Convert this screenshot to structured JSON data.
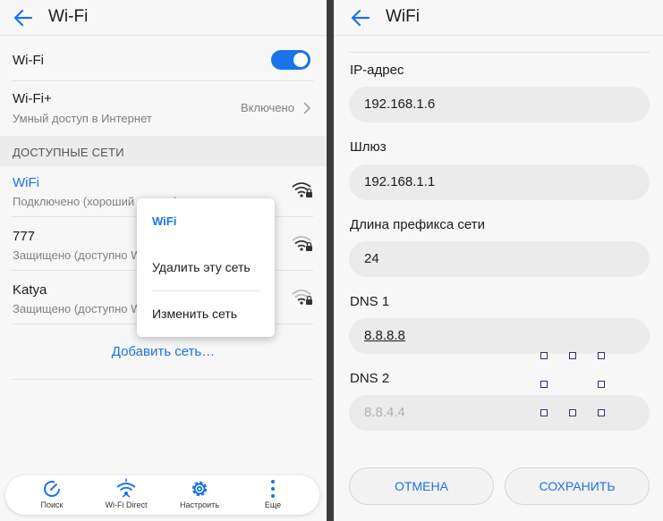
{
  "left": {
    "title": "Wi-Fi",
    "wifi_toggle": {
      "label": "Wi-Fi",
      "on": true
    },
    "wifi_plus": {
      "label": "Wi-Fi+",
      "subtitle": "Умный доступ в Интернет",
      "value": "Включено"
    },
    "section_header": "ДОСТУПНЫЕ СЕТИ",
    "networks": [
      {
        "name": "WiFi",
        "status": "Подключено (хороший сигнал)",
        "icon": "wifi-secured-icon",
        "active": true
      },
      {
        "name": "777",
        "status": "Защищено (доступно WPS)",
        "icon": "wifi-secured-icon",
        "active": false
      },
      {
        "name": "Katya",
        "status": "Защищено (доступно WPS)",
        "icon": "wifi-secured-icon",
        "active": false
      }
    ],
    "add_network": "Добавить сеть…",
    "context_menu": {
      "title": "WiFi",
      "items": [
        "Удалить эту сеть",
        "Изменить сеть"
      ]
    },
    "bottom_nav": [
      {
        "label": "Поиск",
        "icon": "refresh-scan-icon"
      },
      {
        "label": "Wi-Fi Direct",
        "icon": "wifi-direct-icon"
      },
      {
        "label": "Настроить",
        "icon": "gear-icon"
      },
      {
        "label": "Еще",
        "icon": "more-vertical-icon"
      }
    ],
    "accent_color": "#1a73e8"
  },
  "right": {
    "title": "WiFi",
    "fields": [
      {
        "label": "IP-адрес",
        "value": "192.168.1.6"
      },
      {
        "label": "Шлюз",
        "value": "192.168.1.1"
      },
      {
        "label": "Длина префикса сети",
        "value": "24"
      },
      {
        "label": "DNS 1",
        "value": "8.8.8.8"
      },
      {
        "label": "DNS 2",
        "placeholder": "8.8.4.4"
      }
    ],
    "cancel_label": "ОТМЕНА",
    "save_label": "СОХРАНИТЬ"
  }
}
